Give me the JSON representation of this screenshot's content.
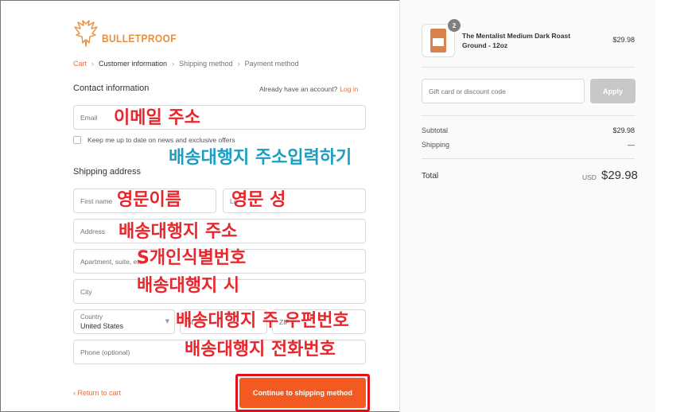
{
  "brand": {
    "logo_text": "BULLETPROOF"
  },
  "breadcrumb": {
    "cart": "Cart",
    "customer_information": "Customer information",
    "shipping_method": "Shipping method",
    "payment_method": "Payment method",
    "separator": "›"
  },
  "contact": {
    "title": "Contact information",
    "account_prompt": "Already have an account?",
    "login_link": "Log in",
    "email_placeholder": "Email",
    "newsletter_label": "Keep me up to date on news and exclusive offers"
  },
  "shipping": {
    "title": "Shipping address",
    "first_name_placeholder": "First name",
    "last_name_placeholder": "La",
    "address_placeholder": "Address",
    "apartment_placeholder": "Apartment, suite, etc.",
    "city_placeholder": "City",
    "country_label": "Country",
    "country_value": "United States",
    "state_placeholder": "St",
    "zip_placeholder": "ZIP",
    "phone_placeholder": "Phone (optional)"
  },
  "annotations": {
    "email": "이메일 주소",
    "header": "배송대행지 주소입력하기",
    "first_name": "영문이름",
    "last_name": "영문 성",
    "address": "배송대행지 주소",
    "apartment": "S개인식별번호",
    "city": "배송대행지 시",
    "state_zip": "배송대행지 주 우편번호",
    "phone": "배송대행지 전화번호"
  },
  "footer": {
    "return_link": "‹ Return to cart",
    "continue_button": "Continue to shipping method"
  },
  "order": {
    "product_name": "The Mentalist Medium Dark Roast Ground - 12oz",
    "product_price": "$29.98",
    "quantity": "2",
    "discount_placeholder": "Gift card or discount code",
    "apply_label": "Apply",
    "subtotal_label": "Subtotal",
    "subtotal_value": "$29.98",
    "shipping_label": "Shipping",
    "shipping_value": "—",
    "total_label": "Total",
    "currency": "USD",
    "total_value": "$29.98"
  },
  "colors": {
    "accent": "#e8703c",
    "button": "#f25a22",
    "annotation_red": "#e8262b",
    "annotation_teal": "#1a9ec2",
    "highlight_border": "#e0101a"
  }
}
